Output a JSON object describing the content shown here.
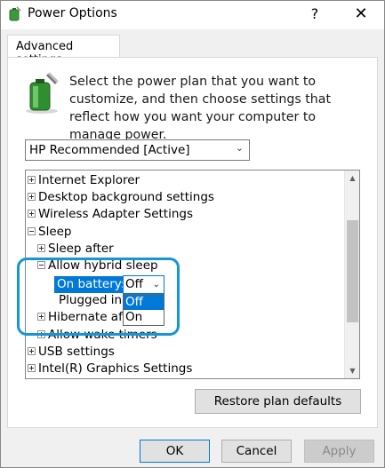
{
  "window": {
    "title": "Power Options",
    "help": "?",
    "close": "✕"
  },
  "tab": {
    "label": "Advanced settings"
  },
  "intro_text": "Select the power plan that you want to customize, and then choose settings that reflect how you want your computer to manage power.",
  "plan": {
    "selected": "HP Recommended [Active]"
  },
  "tree": {
    "items": [
      {
        "label": "Internet Explorer",
        "expander": "plus"
      },
      {
        "label": "Desktop background settings",
        "expander": "plus"
      },
      {
        "label": "Wireless Adapter Settings",
        "expander": "plus"
      },
      {
        "label": "Sleep",
        "expander": "minus"
      },
      {
        "label": "Sleep after",
        "expander": "plus"
      },
      {
        "label": "Allow hybrid sleep",
        "expander": "minus"
      },
      {
        "label": "On battery:",
        "expander": "none"
      },
      {
        "label": "Plugged in:",
        "expander": "none"
      },
      {
        "label": "Hibernate afte",
        "expander": "plus"
      },
      {
        "label": "Allow wake timers",
        "expander": "plus"
      },
      {
        "label": "USB settings",
        "expander": "plus"
      },
      {
        "label": "Intel(R) Graphics Settings",
        "expander": "plus"
      }
    ],
    "on_battery_value": "Off",
    "dropdown_options": [
      "Off",
      "On"
    ]
  },
  "buttons": {
    "restore": "Restore plan defaults",
    "ok": "OK",
    "cancel": "Cancel",
    "apply": "Apply"
  },
  "colors": {
    "accent": "#0078d7",
    "ring": "#1496d8"
  }
}
